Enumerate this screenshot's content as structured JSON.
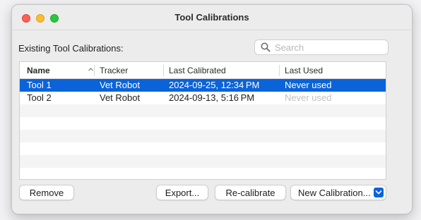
{
  "window": {
    "title": "Tool Calibrations"
  },
  "section_label": "Existing Tool Calibrations:",
  "search": {
    "placeholder": "Search",
    "value": ""
  },
  "table": {
    "columns": [
      "Name",
      "Tracker",
      "Last Calibrated",
      "Last Used"
    ],
    "sort_column": "Name",
    "rows": [
      {
        "name": "Tool 1",
        "tracker": "Vet Robot",
        "last_calibrated": "2024-09-25, 12:34 PM",
        "last_used": "Never used",
        "selected": true
      },
      {
        "name": "Tool 2",
        "tracker": "Vet Robot",
        "last_calibrated": "2024-09-13, 5:16 PM",
        "last_used": "Never used",
        "selected": false
      }
    ]
  },
  "buttons": {
    "remove": "Remove",
    "export": "Export...",
    "recalibrate": "Re-calibrate",
    "new_calibration": "New Calibration..."
  },
  "colors": {
    "selection": "#0a63d9",
    "close": "#ff5f57",
    "minimize": "#febc2e",
    "maximize": "#28c840"
  },
  "icons": {
    "search": "magnifier-icon",
    "sort": "chevron-up-icon",
    "dropdown": "chevron-down-icon"
  }
}
